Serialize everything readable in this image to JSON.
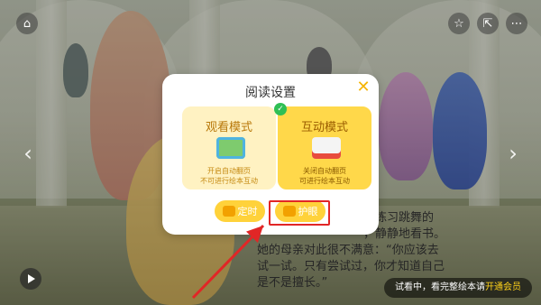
{
  "dialog": {
    "title": "阅读设置",
    "modes": [
      {
        "title": "观看模式",
        "desc_line1": "开启自动翻页",
        "desc_line2": "不可进行绘本互动",
        "selected": false
      },
      {
        "title": "互动模式",
        "desc_line1": "关闭自动翻页",
        "desc_line2": "可进行绘本互动",
        "selected": true
      }
    ],
    "timer_label": "定时",
    "eye_label": "护眼"
  },
  "story": {
    "line1": "儿练习跳舞的",
    "line2": "，静静地看书。",
    "line3": "她的母亲对此很不满意：“你应该去",
    "line4": "试一试。只有尝试过，你才知道自己",
    "line5": "是不是擅长。”"
  },
  "trial": {
    "text": "试看中，看完整绘本请",
    "link": "开通会员"
  },
  "icons": {
    "home": "home-icon",
    "favorite": "star-icon",
    "share": "share-icon",
    "more": "more-icon",
    "left": "chevron-left-icon",
    "right": "chevron-right-icon",
    "play": "play-icon"
  },
  "colors": {
    "accent": "#ffd23a",
    "highlight": "#e12626"
  }
}
